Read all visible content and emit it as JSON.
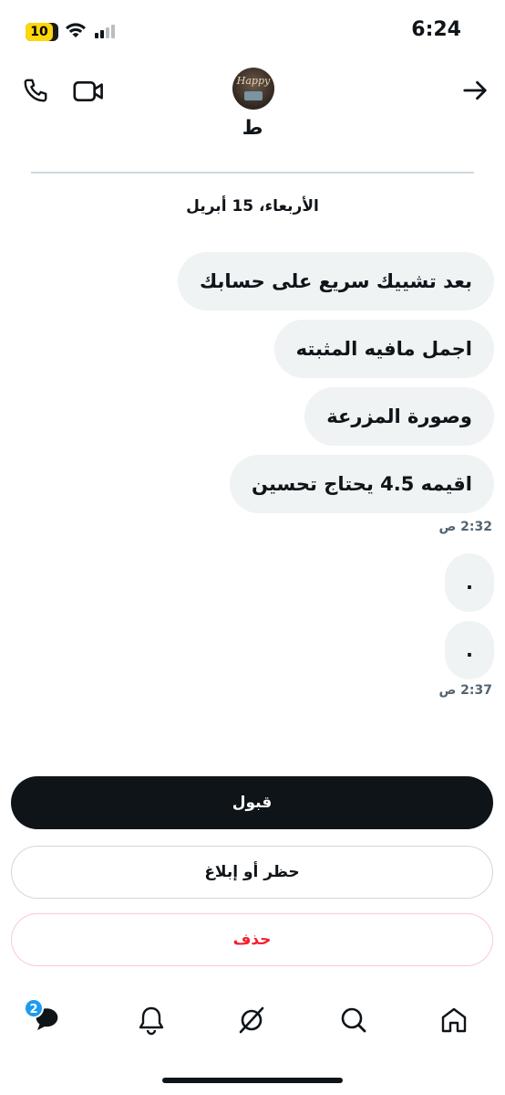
{
  "status_bar": {
    "battery_level": "10",
    "time": "6:24",
    "icons": [
      "wifi-icon",
      "signal-icon"
    ]
  },
  "header": {
    "contact_name": "ط",
    "avatar_text": "Happy",
    "icons": [
      "call-icon",
      "video-icon",
      "back-arrow-icon"
    ]
  },
  "conversation": {
    "date": "الأربعاء، 15 أبريل",
    "groups": [
      {
        "messages": [
          "بعد تشييك سريع على حسابك",
          "اجمل مافيه المثبته",
          "وصورة المزرعة",
          "اقيمه 4.5 يحتاج تحسين"
        ],
        "time": "2:32 ص"
      },
      {
        "messages": [
          ".",
          "."
        ],
        "time": "2:37 ص"
      }
    ]
  },
  "actions": {
    "accept_label": "قبول",
    "block_report_label": "حظر أو إبلاغ",
    "delete_label": "حذف"
  },
  "bottom_nav": {
    "messages_badge": "2",
    "items": [
      "messages-icon",
      "notifications-icon",
      "grok-icon",
      "search-icon",
      "home-icon"
    ]
  },
  "colors": {
    "accent": "#1d9bf0",
    "primary_button": "#0f1419",
    "delete_text": "#f4212e",
    "bubble_bg": "#eff3f4",
    "battery": "#ffd60a"
  }
}
